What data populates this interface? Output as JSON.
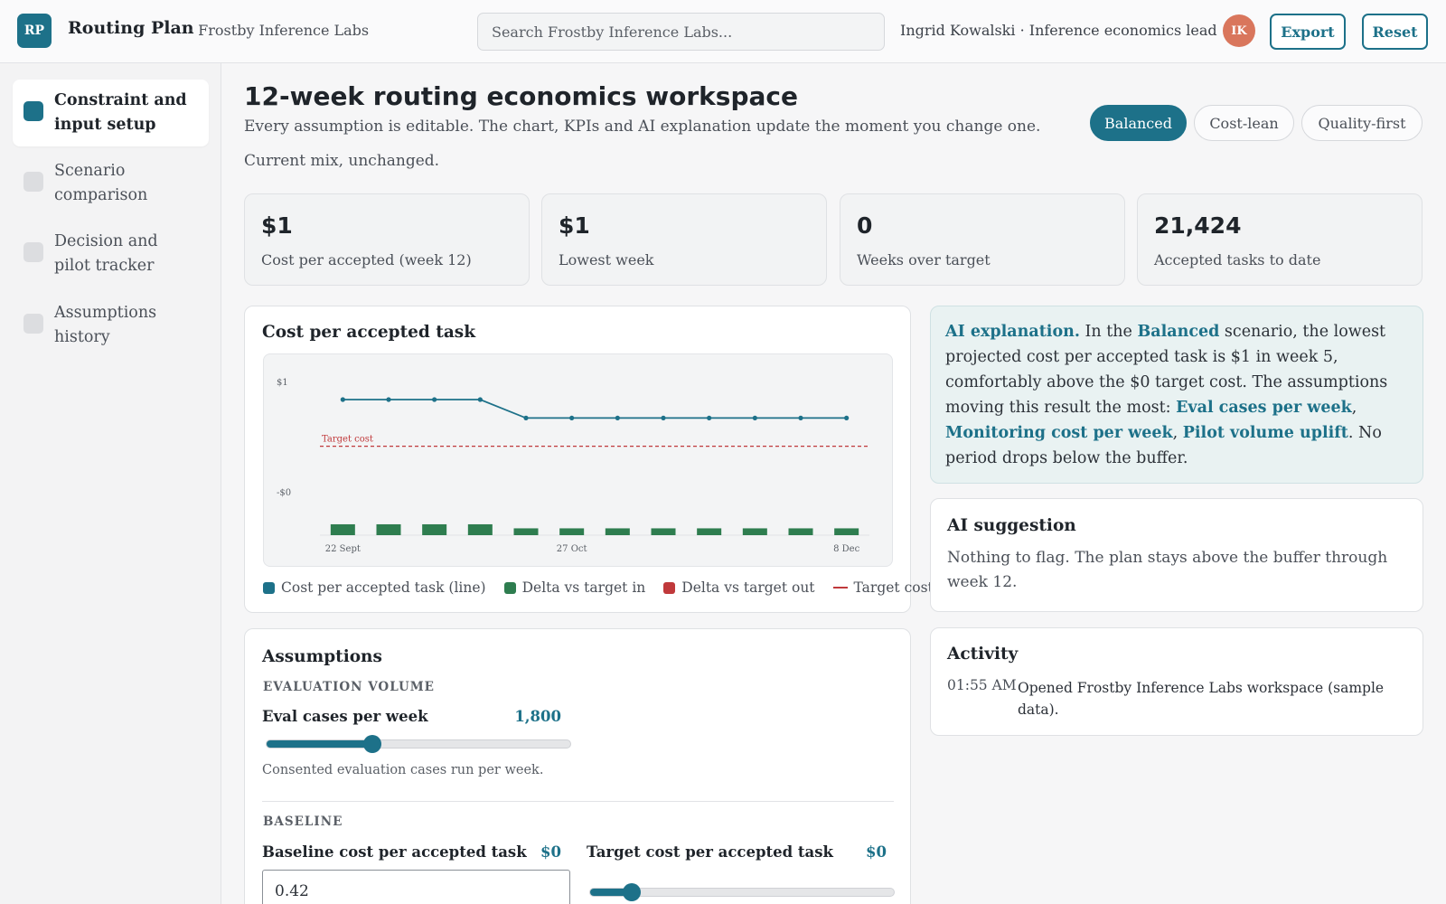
{
  "header": {
    "logo": "RP",
    "app_title": "Routing Plan",
    "org": "· Frostby Inference Labs",
    "search_placeholder": "Search Frostby Inference Labs...",
    "user": "Ingrid Kowalski · Inference economics lead",
    "avatar_initials": "IK",
    "export_label": "Export",
    "reset_label": "Reset"
  },
  "sidebar": {
    "items": [
      {
        "label": "Constraint and input setup",
        "active": true
      },
      {
        "label": "Scenario comparison",
        "active": false
      },
      {
        "label": "Decision and pilot tracker",
        "active": false
      },
      {
        "label": "Assumptions history",
        "active": false
      }
    ]
  },
  "main": {
    "title": "12-week routing economics workspace",
    "subtitle": "Every assumption is editable. The chart, KPIs and AI explanation update the moment you change one.",
    "status": "Current mix, unchanged.",
    "scenarios": [
      {
        "label": "Balanced",
        "active": true
      },
      {
        "label": "Cost-lean",
        "active": false
      },
      {
        "label": "Quality-first",
        "active": false
      }
    ]
  },
  "kpis": [
    {
      "value": "$1",
      "label": "Cost per accepted (week 12)"
    },
    {
      "value": "$1",
      "label": "Lowest week"
    },
    {
      "value": "0",
      "label": "Weeks over target"
    },
    {
      "value": "21,424",
      "label": "Accepted tasks to date"
    }
  ],
  "chart_card": {
    "title": "Cost per accepted task",
    "legend": [
      {
        "label": "Cost per accepted task (line)",
        "color": "#1d7189",
        "kind": "square"
      },
      {
        "label": "Delta vs target in",
        "color": "#2e7d4f",
        "kind": "square"
      },
      {
        "label": "Delta vs target out",
        "color": "#c0393b",
        "kind": "square"
      },
      {
        "label": "Target cost",
        "color": "#c0393b",
        "kind": "line"
      }
    ]
  },
  "chart_data": {
    "type": "line",
    "title": "Cost per accepted task",
    "x_tick_labels": [
      "22 Sept",
      "27 Oct",
      "8 Dec"
    ],
    "y_tick_labels": [
      "$1",
      "-$0"
    ],
    "target_label": "Target cost",
    "series": [
      {
        "name": "Cost per accepted task (line)",
        "type": "line",
        "color": "#1d7189",
        "values": [
          0.75,
          0.75,
          0.75,
          0.75,
          0.58,
          0.58,
          0.58,
          0.58,
          0.58,
          0.58,
          0.58,
          0.58
        ]
      },
      {
        "name": "Delta vs target in",
        "type": "bar",
        "color": "#2e7d4f",
        "values": [
          0.43,
          0.43,
          0.43,
          0.43,
          0.27,
          0.27,
          0.27,
          0.27,
          0.27,
          0.27,
          0.27,
          0.27
        ]
      }
    ],
    "target_value": 0.32,
    "ylim": [
      -0.5,
      1
    ],
    "grid": false
  },
  "ai_explanation": {
    "lead": "AI explanation.",
    "t1": " In the ",
    "scenario": "Balanced",
    "t2": " scenario, the lowest projected cost per accepted task is $1 in week 5, comfortably above the $0 target cost. The assumptions moving this result the most: ",
    "driver1": "Eval cases per week",
    "sep1": ", ",
    "driver2": "Monitoring cost per week",
    "sep2": ", ",
    "driver3": "Pilot volume uplift",
    "t3": ". No period drops below the buffer."
  },
  "ai_suggestion": {
    "title": "AI suggestion",
    "text": "Nothing to flag. The plan stays above the buffer through week 12."
  },
  "activity": {
    "title": "Activity",
    "entries": [
      {
        "time": "01:55 AM",
        "text": "Opened Frostby Inference Labs workspace (sample data)."
      }
    ]
  },
  "assumptions": {
    "title": "Assumptions",
    "eval_section": "EVALUATION VOLUME",
    "eval_label": "Eval cases per week",
    "eval_value": "1,800",
    "eval_fraction": 0.35,
    "eval_help": "Consented evaluation cases run per week.",
    "baseline_section": "BASELINE",
    "baseline_label": "Baseline cost per accepted task",
    "baseline_value": "$0",
    "baseline_input": "0.42",
    "target_label": "Target cost per accepted task",
    "target_value": "$0",
    "target_fraction": 0.14
  }
}
